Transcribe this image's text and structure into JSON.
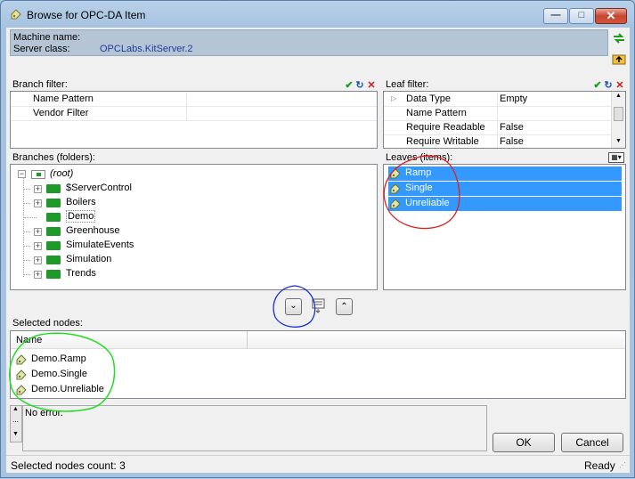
{
  "window": {
    "title": "Browse for OPC-DA Item",
    "minimize": "—",
    "maximize": "□",
    "close": "✕"
  },
  "server": {
    "machine_name_label": "Machine name:",
    "machine_name_value": "",
    "server_class_label": "Server class:",
    "server_class_value": "OPCLabs.KitServer.2"
  },
  "branch_filter": {
    "label": "Branch filter:",
    "rows": [
      {
        "key": "Name Pattern",
        "value": ""
      },
      {
        "key": "Vendor Filter",
        "value": ""
      }
    ]
  },
  "leaf_filter": {
    "label": "Leaf filter:",
    "rows": [
      {
        "key": "Data Type",
        "value": "Empty"
      },
      {
        "key": "Name Pattern",
        "value": ""
      },
      {
        "key": "Require Readable",
        "value": "False"
      },
      {
        "key": "Require Writable",
        "value": "False"
      }
    ]
  },
  "branches": {
    "label": "Branches (folders):",
    "root": "(root)",
    "items": [
      "$ServerControl",
      "Boilers",
      "Demo",
      "Greenhouse",
      "SimulateEvents",
      "Simulation",
      "Trends"
    ]
  },
  "leaves": {
    "label": "Leaves (items):",
    "items": [
      "Ramp",
      "Single",
      "Unreliable"
    ]
  },
  "selected": {
    "label": "Selected nodes:",
    "column": "Name",
    "items": [
      "Demo.Ramp",
      "Demo.Single",
      "Demo.Unreliable"
    ]
  },
  "message": "No error.",
  "buttons": {
    "ok": "OK",
    "cancel": "Cancel"
  },
  "status": {
    "count_text": "Selected nodes count: 3",
    "state": "Ready"
  },
  "colors": {
    "selection": "#3399ff",
    "folder": "#1f9a2a",
    "annotation_red": "#e02020",
    "annotation_blue": "#1a2fd0",
    "annotation_green": "#22dd22"
  }
}
